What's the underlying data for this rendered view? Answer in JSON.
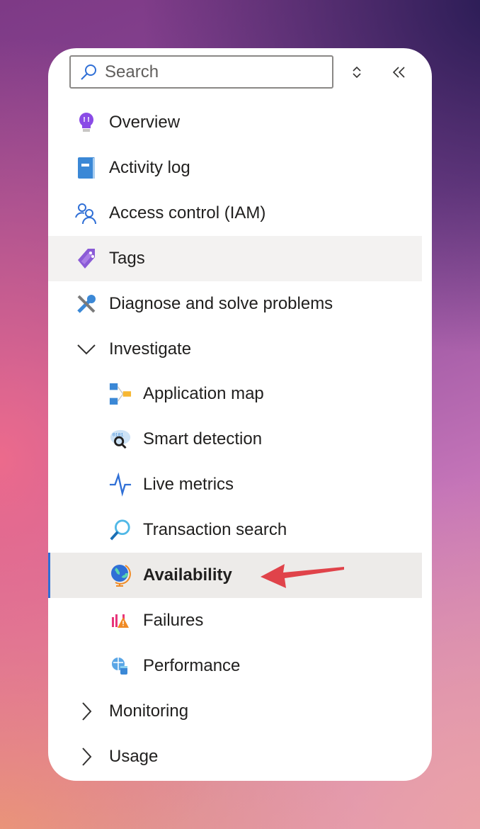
{
  "search": {
    "placeholder": "Search"
  },
  "toolbar": {
    "sort_icon": "chevron-up-down-icon",
    "collapse_icon": "double-chevron-left-icon"
  },
  "accent": "#2f6fd6",
  "menu": [
    {
      "label": "Overview",
      "icon": "lightbulb-icon",
      "level": 0
    },
    {
      "label": "Activity log",
      "icon": "book-icon",
      "level": 0
    },
    {
      "label": "Access control (IAM)",
      "icon": "people-icon",
      "level": 0
    },
    {
      "label": "Tags",
      "icon": "tag-icon",
      "level": 0,
      "state": "hover"
    },
    {
      "label": "Diagnose and solve problems",
      "icon": "wrench-icon",
      "level": 0
    },
    {
      "label": "Investigate",
      "icon": "chevron-down-icon",
      "level": 0,
      "expanded": true
    },
    {
      "label": "Application map",
      "icon": "app-map-icon",
      "level": 1
    },
    {
      "label": "Smart detection",
      "icon": "smart-detection-icon",
      "level": 1
    },
    {
      "label": "Live metrics",
      "icon": "pulse-icon",
      "level": 1
    },
    {
      "label": "Transaction search",
      "icon": "magnifier-icon",
      "level": 1
    },
    {
      "label": "Availability",
      "icon": "globe-icon",
      "level": 1,
      "state": "selected"
    },
    {
      "label": "Failures",
      "icon": "failures-icon",
      "level": 1
    },
    {
      "label": "Performance",
      "icon": "performance-icon",
      "level": 1
    },
    {
      "label": "Monitoring",
      "icon": "chevron-right-icon",
      "level": 0,
      "expanded": false
    },
    {
      "label": "Usage",
      "icon": "chevron-right-icon",
      "level": 0,
      "expanded": false
    }
  ],
  "annotation": {
    "icon": "red-arrow-icon",
    "color": "#e0434a"
  }
}
